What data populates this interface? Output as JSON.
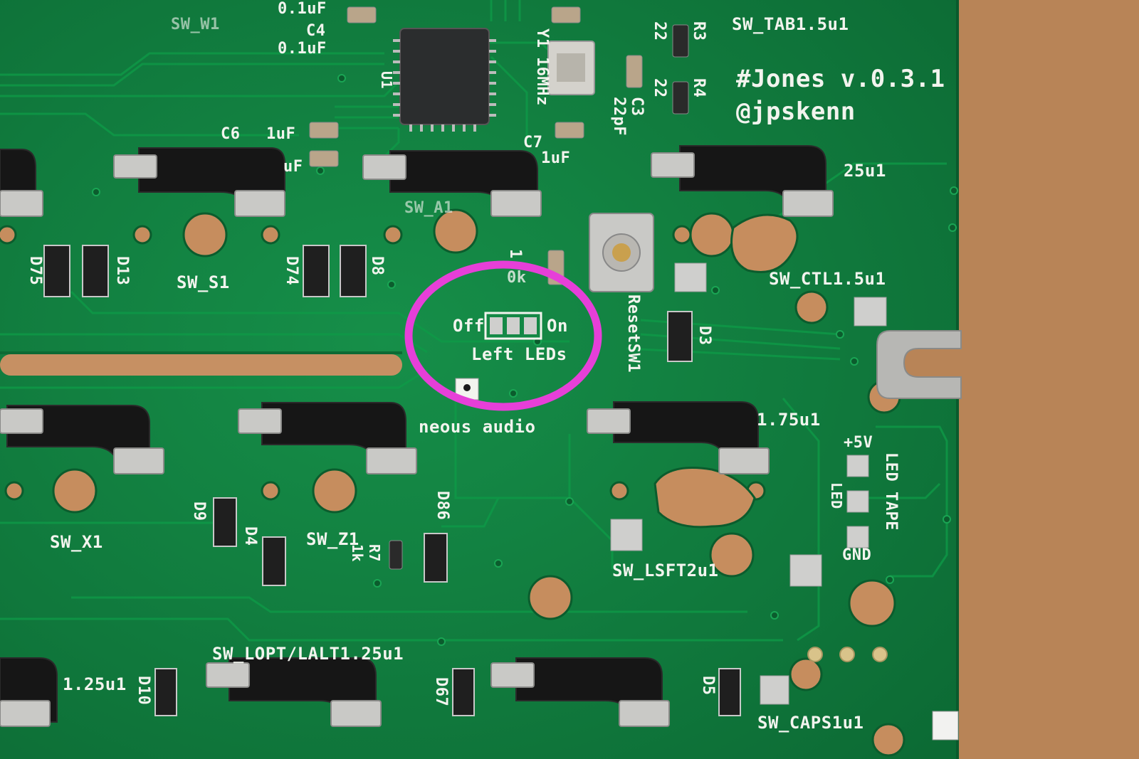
{
  "colors": {
    "pcb_green": "#117a3e",
    "wood": "#b88457",
    "silkscreen": "#f2f4ee",
    "annotation_circle": "#e63fd8",
    "hotswap_socket": "#151515"
  },
  "board_branding": {
    "title": "#Jones v.0.3.1",
    "author": "@jpskenn"
  },
  "switch_labels": [
    {
      "id": "sw-tab",
      "text": "SW_TAB1.5u1"
    },
    {
      "id": "sw-a1",
      "text": "SW_A1"
    },
    {
      "id": "sw-w1",
      "text": "SW_W1"
    },
    {
      "id": "sw-s1",
      "text": "SW_S1"
    },
    {
      "id": "sw-ctl",
      "text": "SW_CTL1.5u1"
    },
    {
      "id": "sw-x1",
      "text": "SW_X1"
    },
    {
      "id": "sw-z1",
      "text": "SW_Z1"
    },
    {
      "id": "sw-lsft",
      "text": "SW_LSFT2u1"
    },
    {
      "id": "sw-lopt",
      "text": "SW_LOPT/LALT1.25u1"
    },
    {
      "id": "sw-caps",
      "text": "SW_CAPS1u1"
    },
    {
      "id": "sw-125a",
      "text": "1.25u1"
    },
    {
      "id": "sw-125b",
      "text": "1.25u1"
    },
    {
      "id": "sw-175",
      "text": "1.75u1"
    },
    {
      "id": "sw-125c",
      "text": "25u1"
    }
  ],
  "component_labels": [
    {
      "id": "c6",
      "text": "C6"
    },
    {
      "id": "c6v",
      "text": "1uF"
    },
    {
      "id": "c5v",
      "text": "uF"
    },
    {
      "id": "c4",
      "text": "C4"
    },
    {
      "id": "c4v",
      "text": "0.1uF"
    },
    {
      "id": "c4v2",
      "text": "0.1uF"
    },
    {
      "id": "c7",
      "text": "C7"
    },
    {
      "id": "c7v",
      "text": "1uF"
    },
    {
      "id": "c3",
      "text": "C3"
    },
    {
      "id": "c3v",
      "text": "22pF"
    },
    {
      "id": "y1",
      "text": "Y1"
    },
    {
      "id": "y1v",
      "text": "16MHz"
    },
    {
      "id": "u1",
      "text": "U1"
    },
    {
      "id": "r3",
      "text": "R3"
    },
    {
      "id": "r3v",
      "text": "22"
    },
    {
      "id": "r4",
      "text": "R4"
    },
    {
      "id": "r4v",
      "text": "22"
    },
    {
      "id": "r7",
      "text": "R7"
    },
    {
      "id": "r7v",
      "text": "1k"
    },
    {
      "id": "d75",
      "text": "D75"
    },
    {
      "id": "d13",
      "text": "D13"
    },
    {
      "id": "d74",
      "text": "D74"
    },
    {
      "id": "d8",
      "text": "D8"
    },
    {
      "id": "d3",
      "text": "D3"
    },
    {
      "id": "d9",
      "text": "D9"
    },
    {
      "id": "d4",
      "text": "D4"
    },
    {
      "id": "d86",
      "text": "D86"
    },
    {
      "id": "d10",
      "text": "D10"
    },
    {
      "id": "d67",
      "text": "D67"
    },
    {
      "id": "d5",
      "text": "D5"
    },
    {
      "id": "reset",
      "text": "ResetSW1"
    },
    {
      "id": "plus5v",
      "text": "+5V"
    },
    {
      "id": "led",
      "text": "LED"
    },
    {
      "id": "gnd",
      "text": "GND"
    },
    {
      "id": "ledtape",
      "text": "LED TAPE"
    },
    {
      "id": "audio",
      "text": "neous audio"
    },
    {
      "id": "tenk",
      "text": "1"
    },
    {
      "id": "ok",
      "text": "0k"
    }
  ],
  "led_switch": {
    "off_label": "Off",
    "on_label": "On",
    "caption": "Left LEDs"
  }
}
